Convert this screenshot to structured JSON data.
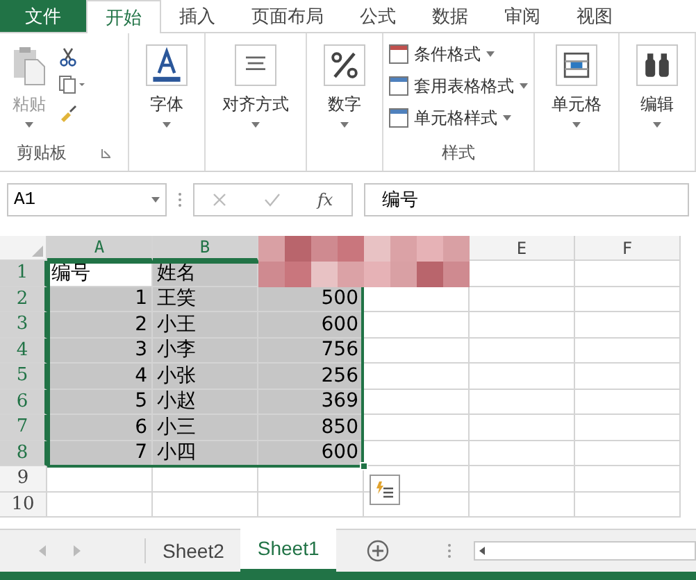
{
  "ribbon_tabs": [
    {
      "label": "文件",
      "kind": "file",
      "selected": false
    },
    {
      "label": "开始",
      "kind": "tab",
      "selected": true
    },
    {
      "label": "插入",
      "kind": "tab",
      "selected": false
    },
    {
      "label": "页面布局",
      "kind": "tab",
      "selected": false
    },
    {
      "label": "公式",
      "kind": "tab",
      "selected": false
    },
    {
      "label": "数据",
      "kind": "tab",
      "selected": false
    },
    {
      "label": "审阅",
      "kind": "tab",
      "selected": false
    },
    {
      "label": "视图",
      "kind": "tab",
      "selected": false
    }
  ],
  "clipboard": {
    "paste": "粘贴",
    "label": "剪贴板"
  },
  "groups": [
    {
      "label": "字体",
      "kind": "font"
    },
    {
      "label": "对齐方式",
      "kind": "align"
    },
    {
      "label": "数字",
      "kind": "number"
    }
  ],
  "styles": {
    "items": [
      "条件格式",
      "套用表格格式",
      "单元格样式"
    ],
    "label": "样式"
  },
  "groups2": [
    {
      "label": "单元格",
      "kind": "cells"
    },
    {
      "label": "编辑",
      "kind": "edit"
    }
  ],
  "name_box": "A1",
  "formula": "编号",
  "fx_label": "fx",
  "columns": [
    {
      "label": "A",
      "selected": true
    },
    {
      "label": "B",
      "selected": true
    },
    {
      "label": "E",
      "selected": false
    },
    {
      "label": "F",
      "selected": false
    }
  ],
  "rows": [
    {
      "header": "1",
      "selected": true,
      "cells": [
        "编号",
        "姓名"
      ]
    },
    {
      "header": "2",
      "selected": true,
      "cells": [
        "1",
        "王笑",
        "500"
      ]
    },
    {
      "header": "3",
      "selected": true,
      "cells": [
        "2",
        "小王",
        "600"
      ]
    },
    {
      "header": "4",
      "selected": true,
      "cells": [
        "3",
        "小李",
        "756"
      ]
    },
    {
      "header": "5",
      "selected": true,
      "cells": [
        "4",
        "小张",
        "256"
      ]
    },
    {
      "header": "6",
      "selected": true,
      "cells": [
        "5",
        "小赵",
        "369"
      ]
    },
    {
      "header": "7",
      "selected": true,
      "cells": [
        "6",
        "小三",
        "850"
      ]
    },
    {
      "header": "8",
      "selected": true,
      "cells": [
        "7",
        "小四",
        "600"
      ]
    },
    {
      "header": "9",
      "selected": false,
      "cells": []
    },
    {
      "header": "10",
      "selected": false,
      "cells": []
    }
  ],
  "sheets": [
    {
      "label": "Sheet2",
      "selected": false
    },
    {
      "label": "Sheet1",
      "selected": true
    }
  ]
}
